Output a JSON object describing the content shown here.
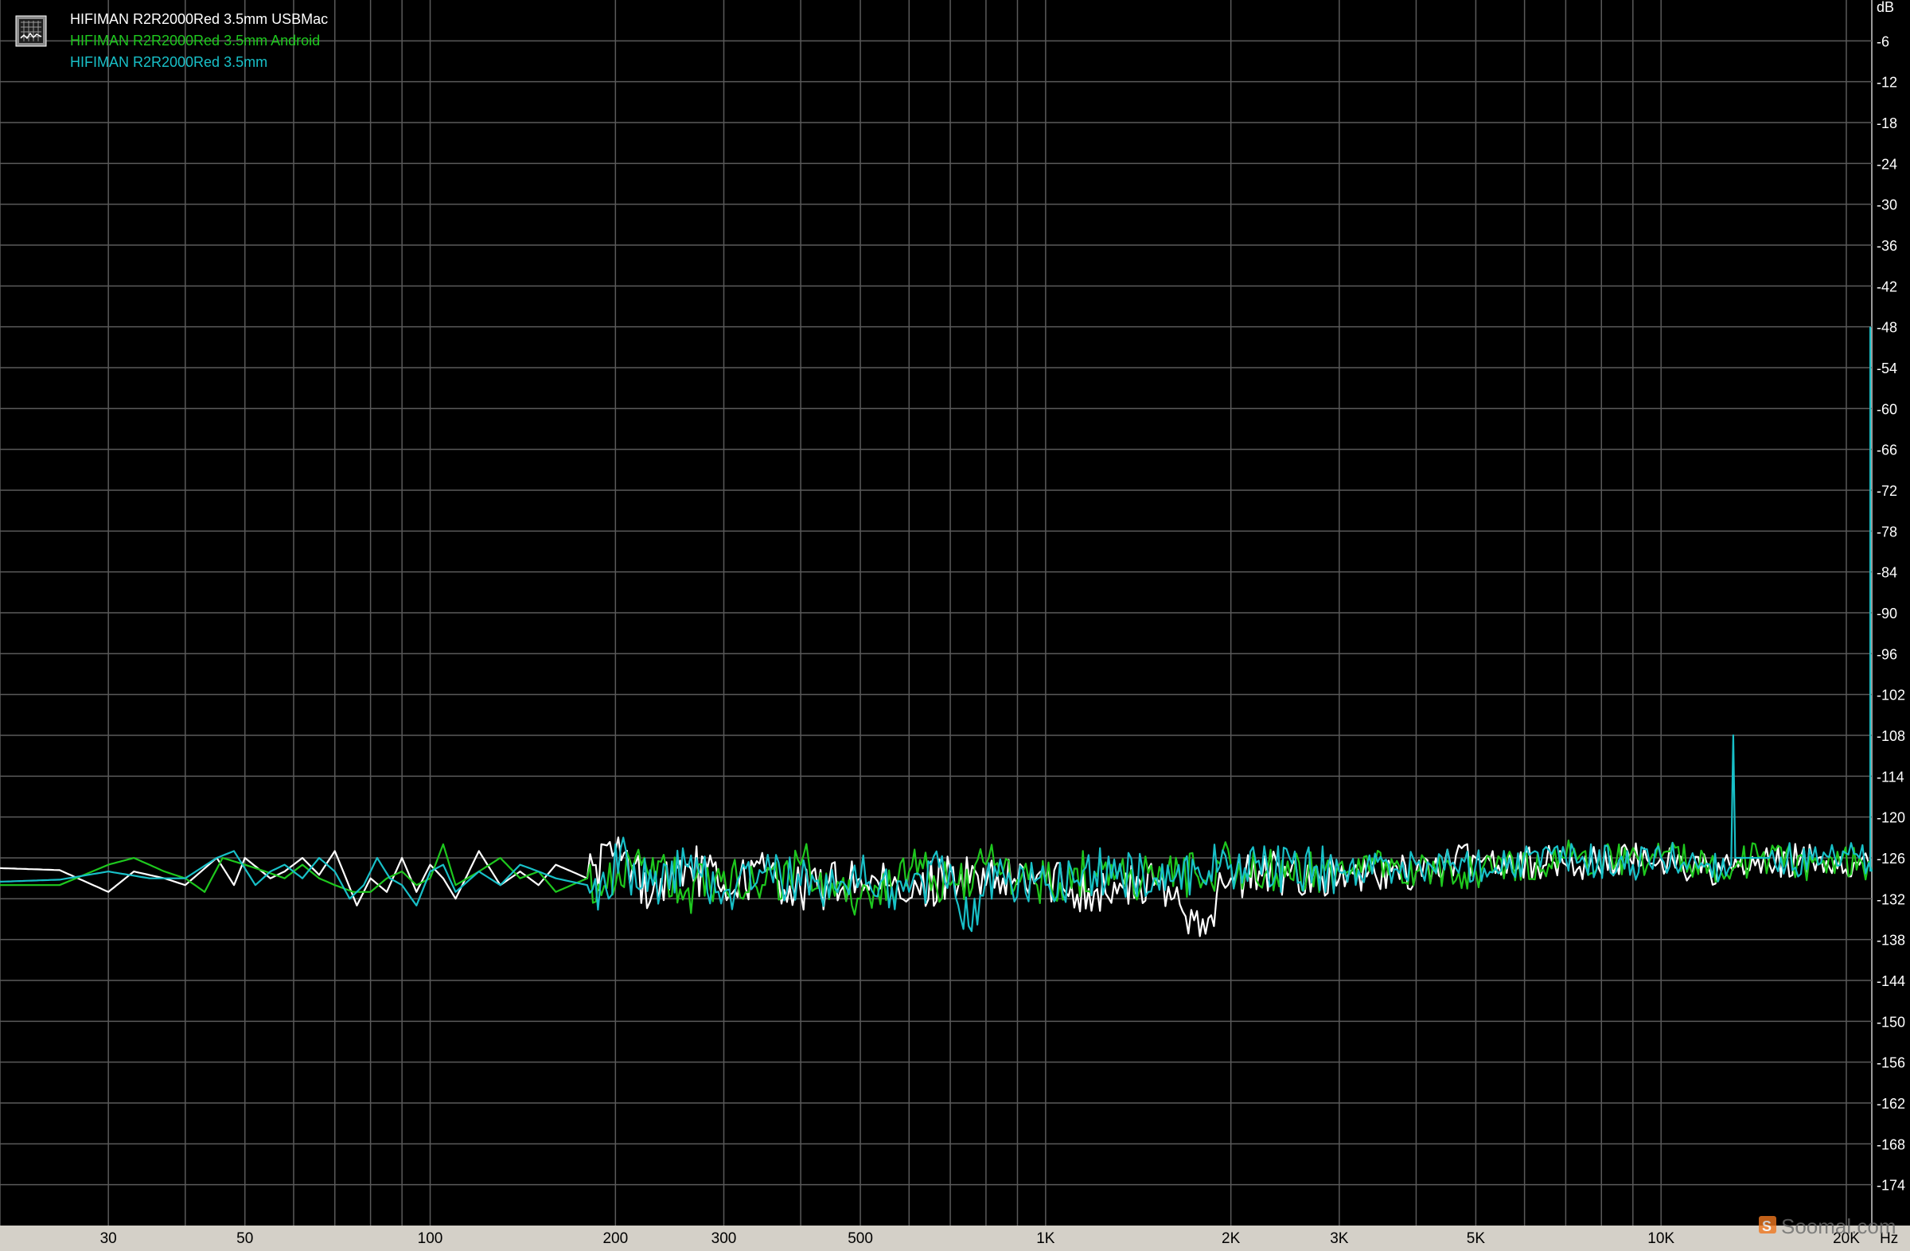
{
  "chart_data": {
    "type": "line",
    "x_scale": "log",
    "xlim": [
      20,
      22000
    ],
    "ylim": [
      -180,
      0
    ],
    "x_unit": "Hz",
    "y_unit": "dB",
    "grid": true,
    "legend_position": "top-left",
    "x_ticks": [
      {
        "value": 30,
        "label": "30"
      },
      {
        "value": 50,
        "label": "50"
      },
      {
        "value": 100,
        "label": "100"
      },
      {
        "value": 200,
        "label": "200"
      },
      {
        "value": 300,
        "label": "300"
      },
      {
        "value": 500,
        "label": "500"
      },
      {
        "value": 1000,
        "label": "1K"
      },
      {
        "value": 2000,
        "label": "2K"
      },
      {
        "value": 3000,
        "label": "3K"
      },
      {
        "value": 5000,
        "label": "5K"
      },
      {
        "value": 10000,
        "label": "10K"
      },
      {
        "value": 20000,
        "label": "20K"
      }
    ],
    "y_ticks": [
      -6,
      -12,
      -18,
      -24,
      -30,
      -36,
      -42,
      -48,
      -54,
      -60,
      -66,
      -72,
      -78,
      -84,
      -90,
      -96,
      -102,
      -108,
      -114,
      -120,
      -126,
      -132,
      -138,
      -144,
      -150,
      -156,
      -162,
      -168,
      -174
    ],
    "series": [
      {
        "name": "HIFIMAN R2R2000Red 3.5mm USBMac",
        "color": "#ffffff",
        "points": [
          [
            20,
            -127.5
          ],
          [
            25,
            -127.8
          ],
          [
            30,
            -131
          ],
          [
            33,
            -128
          ],
          [
            37,
            -129
          ],
          [
            40,
            -130
          ],
          [
            45,
            -126
          ],
          [
            48,
            -130
          ],
          [
            50,
            -126
          ],
          [
            55,
            -129
          ],
          [
            58,
            -128
          ],
          [
            62,
            -126
          ],
          [
            66,
            -128.5
          ],
          [
            70,
            -125
          ],
          [
            73,
            -129
          ],
          [
            76,
            -133
          ],
          [
            80,
            -129
          ],
          [
            85,
            -131
          ],
          [
            90,
            -126
          ],
          [
            95,
            -131
          ],
          [
            100,
            -127
          ],
          [
            105,
            -129
          ],
          [
            110,
            -132
          ],
          [
            120,
            -125
          ],
          [
            130,
            -130
          ],
          [
            140,
            -128
          ],
          [
            150,
            -130
          ],
          [
            160,
            -127
          ],
          [
            180,
            -129
          ],
          [
            200,
            -125
          ],
          [
            230,
            -131
          ],
          [
            260,
            -127
          ],
          [
            300,
            -130
          ],
          [
            350,
            -128
          ],
          [
            400,
            -131
          ],
          [
            500,
            -129
          ],
          [
            600,
            -132
          ],
          [
            700,
            -128
          ],
          [
            800,
            -130
          ],
          [
            1000,
            -129
          ],
          [
            1200,
            -131
          ],
          [
            1500,
            -130
          ],
          [
            1800,
            -135
          ],
          [
            2000,
            -129
          ],
          [
            2500,
            -128
          ],
          [
            3000,
            -129
          ],
          [
            4000,
            -128
          ],
          [
            5000,
            -126
          ],
          [
            7000,
            -127
          ],
          [
            10000,
            -126
          ],
          [
            12000,
            -128
          ],
          [
            15000,
            -127
          ],
          [
            18000,
            -126
          ],
          [
            21000,
            -127
          ],
          [
            22000,
            -128
          ]
        ]
      },
      {
        "name": "HIFIMAN R2R2000Red 3.5mm Android",
        "color": "#1ec81e",
        "points": [
          [
            20,
            -130
          ],
          [
            25,
            -130
          ],
          [
            30,
            -127
          ],
          [
            33,
            -126
          ],
          [
            37,
            -128
          ],
          [
            40,
            -129
          ],
          [
            43,
            -131
          ],
          [
            46,
            -126
          ],
          [
            50,
            -127
          ],
          [
            54,
            -128
          ],
          [
            58,
            -129
          ],
          [
            62,
            -127
          ],
          [
            66,
            -129
          ],
          [
            70,
            -130
          ],
          [
            75,
            -131
          ],
          [
            80,
            -131
          ],
          [
            85,
            -129
          ],
          [
            90,
            -128
          ],
          [
            95,
            -130
          ],
          [
            100,
            -129
          ],
          [
            105,
            -124
          ],
          [
            110,
            -130
          ],
          [
            120,
            -128
          ],
          [
            130,
            -126
          ],
          [
            140,
            -129
          ],
          [
            150,
            -128
          ],
          [
            160,
            -131
          ],
          [
            180,
            -129
          ],
          [
            200,
            -130
          ],
          [
            230,
            -126
          ],
          [
            260,
            -131
          ],
          [
            300,
            -128
          ],
          [
            350,
            -130
          ],
          [
            400,
            -127
          ],
          [
            500,
            -132
          ],
          [
            600,
            -128
          ],
          [
            700,
            -130
          ],
          [
            800,
            -127
          ],
          [
            1000,
            -130
          ],
          [
            1200,
            -128
          ],
          [
            1500,
            -129
          ],
          [
            2000,
            -127
          ],
          [
            2500,
            -129
          ],
          [
            3000,
            -127
          ],
          [
            4000,
            -128
          ],
          [
            5000,
            -128
          ],
          [
            7000,
            -126
          ],
          [
            10000,
            -126
          ],
          [
            12000,
            -127
          ],
          [
            15000,
            -126
          ],
          [
            18000,
            -127
          ],
          [
            21000,
            -126
          ],
          [
            22000,
            -128
          ]
        ]
      },
      {
        "name": "HIFIMAN R2R2000Red 3.5mm",
        "color": "#18c0c8",
        "points": [
          [
            20,
            -129.5
          ],
          [
            25,
            -129.2
          ],
          [
            30,
            -128
          ],
          [
            35,
            -129
          ],
          [
            40,
            -129
          ],
          [
            45,
            -126
          ],
          [
            48,
            -125
          ],
          [
            52,
            -130
          ],
          [
            55,
            -128
          ],
          [
            58,
            -127
          ],
          [
            62,
            -129
          ],
          [
            66,
            -126
          ],
          [
            70,
            -128
          ],
          [
            74,
            -132
          ],
          [
            78,
            -130
          ],
          [
            82,
            -126
          ],
          [
            86,
            -129
          ],
          [
            90,
            -130
          ],
          [
            95,
            -133
          ],
          [
            100,
            -128
          ],
          [
            105,
            -127
          ],
          [
            110,
            -131
          ],
          [
            120,
            -128
          ],
          [
            130,
            -130
          ],
          [
            140,
            -127
          ],
          [
            150,
            -128
          ],
          [
            160,
            -129
          ],
          [
            180,
            -130
          ],
          [
            195,
            -132
          ],
          [
            200,
            -124
          ],
          [
            210,
            -128
          ],
          [
            230,
            -130
          ],
          [
            260,
            -127
          ],
          [
            300,
            -131
          ],
          [
            350,
            -128
          ],
          [
            400,
            -130
          ],
          [
            500,
            -129
          ],
          [
            600,
            -131
          ],
          [
            700,
            -127
          ],
          [
            750,
            -136
          ],
          [
            800,
            -129
          ],
          [
            1000,
            -130
          ],
          [
            1200,
            -128
          ],
          [
            1500,
            -129
          ],
          [
            2000,
            -127
          ],
          [
            3000,
            -128
          ],
          [
            4000,
            -127
          ],
          [
            5000,
            -127
          ],
          [
            7000,
            -126
          ],
          [
            9000,
            -127
          ],
          [
            10000,
            -126
          ],
          [
            12000,
            -127
          ],
          [
            13000,
            -127
          ],
          [
            13100,
            -108
          ],
          [
            13200,
            -126
          ],
          [
            15000,
            -126
          ],
          [
            18000,
            -127
          ],
          [
            21000,
            -126
          ],
          [
            22000,
            -128
          ]
        ]
      }
    ]
  }
}
